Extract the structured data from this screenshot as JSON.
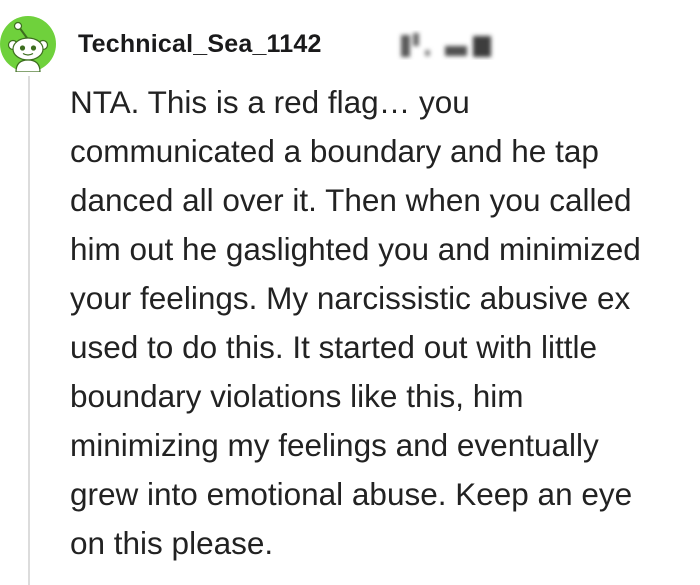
{
  "comment": {
    "author": "Technical_Sea_1142",
    "avatar_icon": "snoo-avatar-icon",
    "avatar_color": "#6fd13c",
    "body": "NTA. This is a red flag… you\ncommunicated a boundary and he tap\ndanced all over it. Then when you called\nhim out he gaslighted you and minimized\nyour feelings. My narcissistic abusive ex\nused to do this. It started out with little\nboundary violations like this, him\nminimizing my feelings and eventually\ngrew into emotional abuse. Keep an eye\non this please."
  }
}
